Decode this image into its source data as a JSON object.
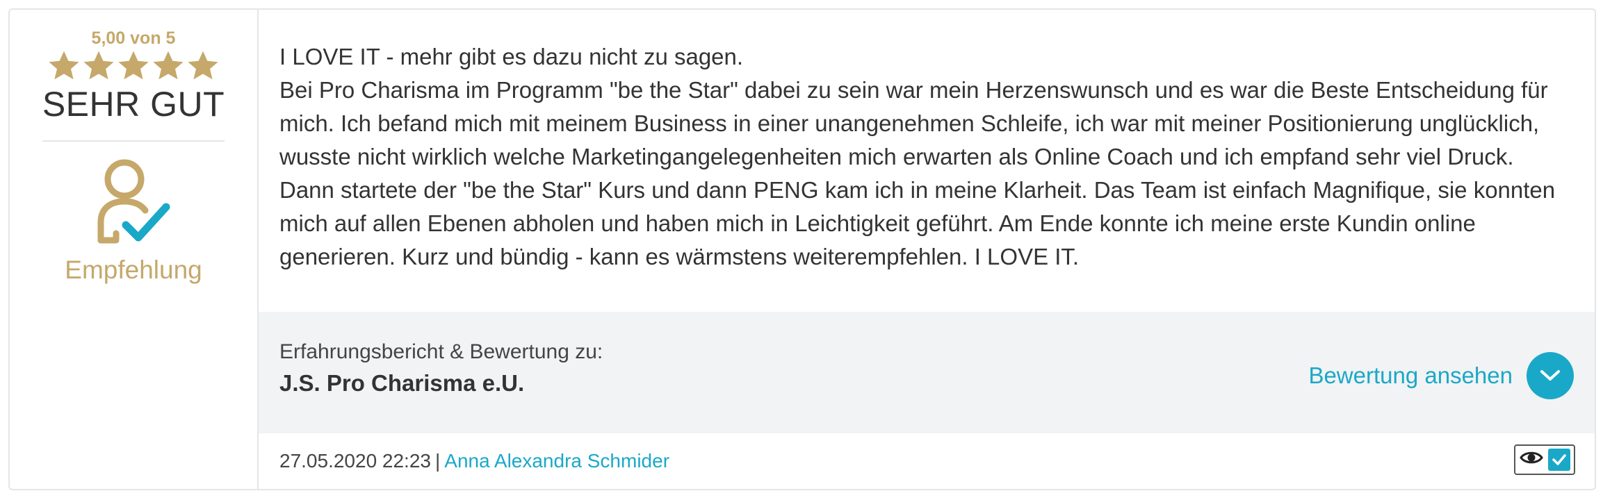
{
  "rating": {
    "score_text": "5,00 von 5",
    "stars": 5,
    "grade": "SEHR GUT",
    "recommendation": "Empfehlung"
  },
  "review": {
    "lines": [
      "I LOVE IT - mehr gibt es dazu nicht zu sagen.",
      "Bei Pro Charisma im Programm \"be the Star\" dabei zu sein war mein Herzenswunsch und es war die Beste Entscheidung für mich. Ich befand mich mit meinem Business in einer unangenehmen Schleife, ich war mit meiner Positionierung unglücklich, wusste nicht wirklich welche Marketingangelegenheiten mich erwarten als Online Coach und ich empfand sehr viel Druck. Dann startete der \"be the Star\" Kurs und dann PENG kam ich in meine Klarheit. Das Team ist einfach Magnifique, sie konnten mich auf allen Ebenen abholen und haben mich in Leichtigkeit geführt. Am Ende konnte ich meine erste Kundin online generieren. Kurz und bündig - kann es wärmstens weiterempfehlen. I LOVE IT."
    ]
  },
  "company": {
    "label": "Erfahrungsbericht & Bewertung zu:",
    "name": "J.S. Pro Charisma e.U.",
    "view_link": "Bewertung ansehen"
  },
  "footer": {
    "datetime": "27.05.2020 22:23",
    "separator": "|",
    "author": "Anna Alexandra Schmider"
  },
  "colors": {
    "gold": "#c5a86a",
    "accent": "#1aa8c8",
    "band": "#f2f3f4"
  },
  "icons": {
    "star": "star-icon",
    "recommend": "person-check-icon",
    "chevron": "chevron-down-icon",
    "eye": "eye-icon",
    "verified": "checkmark-icon"
  }
}
